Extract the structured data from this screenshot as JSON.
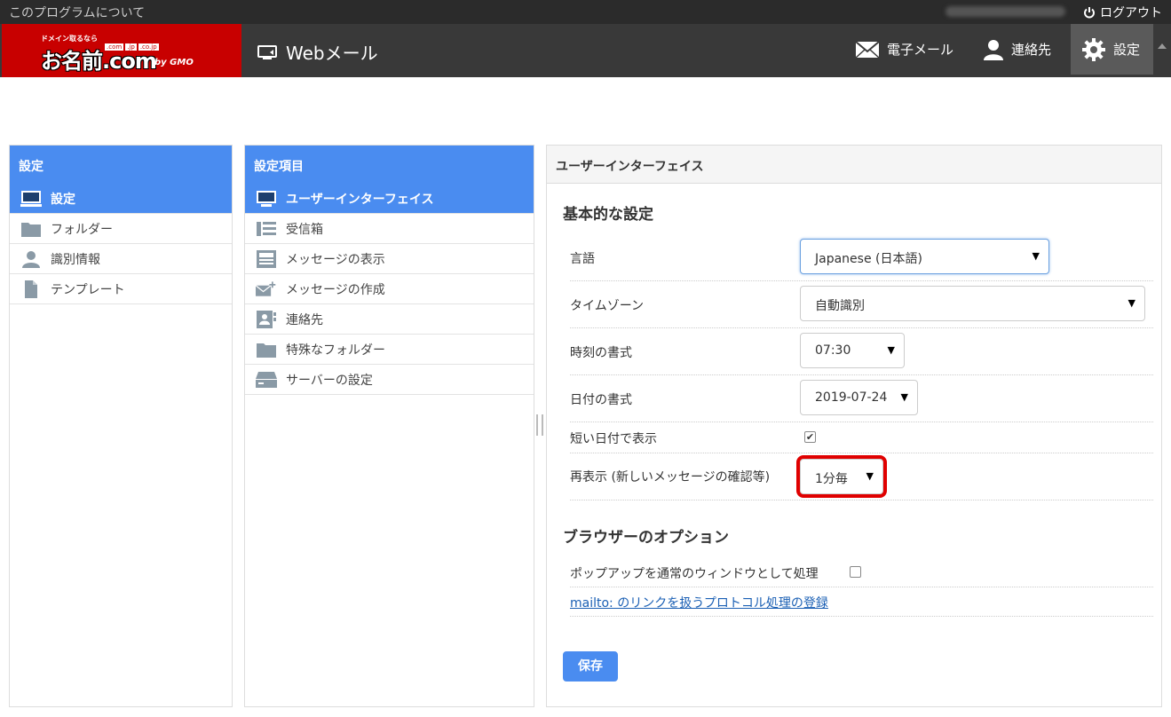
{
  "topbar": {
    "about": "このプログラムについて",
    "logout": "ログアウト"
  },
  "logo": {
    "tagline": "ドメイン取るなら",
    "tlds": [
      ".com",
      ".jp",
      ".co.jp"
    ],
    "brand": "お名前.com",
    "by": "by GMO"
  },
  "header": {
    "app_title": "Webメール",
    "nav": {
      "mail": "電子メール",
      "contacts": "連絡先",
      "settings": "設定"
    }
  },
  "sidebar": {
    "title": "設定",
    "items": [
      {
        "label": "設定",
        "icon": "monitor-icon"
      },
      {
        "label": "フォルダー",
        "icon": "folder-icon"
      },
      {
        "label": "識別情報",
        "icon": "identity-icon"
      },
      {
        "label": "テンプレート",
        "icon": "document-icon"
      }
    ]
  },
  "sections_panel": {
    "title": "設定項目",
    "items": [
      {
        "label": "ユーザーインターフェイス",
        "icon": "monitor-icon"
      },
      {
        "label": "受信箱",
        "icon": "list-icon"
      },
      {
        "label": "メッセージの表示",
        "icon": "message-view-icon"
      },
      {
        "label": "メッセージの作成",
        "icon": "compose-icon"
      },
      {
        "label": "連絡先",
        "icon": "contact-card-icon"
      },
      {
        "label": "特殊なフォルダー",
        "icon": "folder-icon"
      },
      {
        "label": "サーバーの設定",
        "icon": "server-icon"
      }
    ]
  },
  "main": {
    "title": "ユーザーインターフェイス",
    "basic_title": "基本的な設定",
    "fields": {
      "language": {
        "label": "言語",
        "value": "Japanese (日本語)"
      },
      "timezone": {
        "label": "タイムゾーン",
        "value": "自動識別"
      },
      "time_format": {
        "label": "時刻の書式",
        "value": "07:30"
      },
      "date_format": {
        "label": "日付の書式",
        "value": "2019-07-24"
      },
      "short_date": {
        "label": "短い日付で表示",
        "checked": true
      },
      "refresh": {
        "label": "再表示 (新しいメッセージの確認等)",
        "value": "1分毎"
      }
    },
    "browser_title": "ブラウザーのオプション",
    "popup": {
      "label": "ポップアップを通常のウィンドウとして処理",
      "checked": false
    },
    "mailto_link": "mailto: のリンクを扱うプロトコル処理の登録",
    "save_button": "保存",
    "highlight_color": "#e00000",
    "accent_color": "#4a8cf0"
  }
}
